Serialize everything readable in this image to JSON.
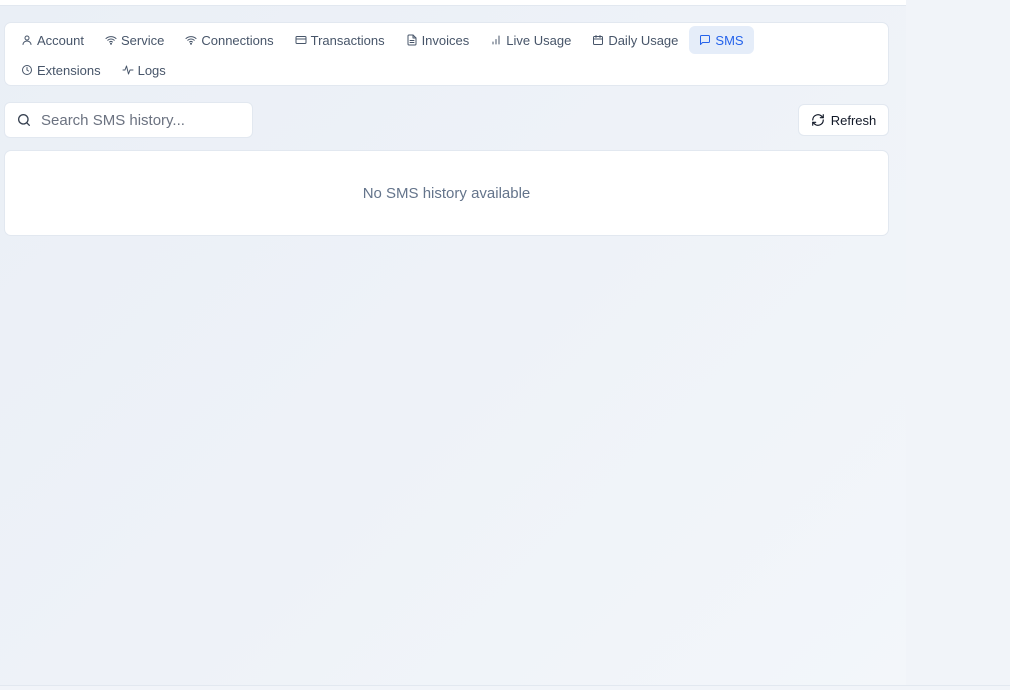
{
  "tabs": [
    {
      "label": "Account",
      "icon": "user-icon"
    },
    {
      "label": "Service",
      "icon": "wifi-icon"
    },
    {
      "label": "Connections",
      "icon": "wifi-icon"
    },
    {
      "label": "Transactions",
      "icon": "credit-card-icon"
    },
    {
      "label": "Invoices",
      "icon": "file-icon"
    },
    {
      "label": "Live Usage",
      "icon": "signal-bars-icon"
    },
    {
      "label": "Daily Usage",
      "icon": "calendar-icon"
    },
    {
      "label": "SMS",
      "icon": "message-icon",
      "active": true
    },
    {
      "label": "Extensions",
      "icon": "clock-icon"
    },
    {
      "label": "Logs",
      "icon": "activity-icon"
    }
  ],
  "search": {
    "placeholder": "Search SMS history...",
    "value": ""
  },
  "toolbar": {
    "refresh_label": "Refresh"
  },
  "empty_state": {
    "message": "No SMS history available"
  },
  "colors": {
    "accent": "#2563eb",
    "active_tab_bg": "#e5edf9",
    "border": "#e2e8f0",
    "muted_text": "#64748b"
  }
}
